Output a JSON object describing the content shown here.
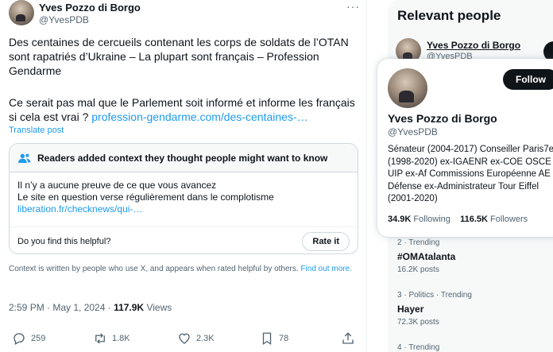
{
  "tweet": {
    "author_name": "Yves Pozzo di Borgo",
    "author_handle": "@YvesPDB",
    "text_line1": "Des centaines de cercueils contenant les corps de soldats de l’OTAN sont rapatriés d’Ukraine – La plupart sont français – Profession Gendarme",
    "text_line2": "Ce serait pas mal que le Parlement soit informé et informe les français si cela est vrai ?",
    "text_link": "profession-gendarme.com/des-centaines-…",
    "translate": "Translate post",
    "timestamp": "2:59 PM · May 1, 2024 · ",
    "views_count": "117.9K",
    "views_label": " Views"
  },
  "community_note": {
    "header": "Readers added context they thought people might want to know",
    "line1": "Il n’y a aucune preuve de ce que vous avancez",
    "line2": "Le site en question verse régulièrement dans le complotisme",
    "link": "liberation.fr/checknews/qui-…",
    "helpful_question": "Do you find this helpful?",
    "rate_button": "Rate it",
    "footer_text": "Context is written by people who use X, and appears when rated helpful by others. ",
    "footer_link": "Find out more."
  },
  "actions": {
    "replies": "259",
    "reposts": "1.8K",
    "likes": "2.3K",
    "bookmarks": "78"
  },
  "sidebar": {
    "relevant_title": "Relevant people",
    "person_name": "Yves Pozzo di Borgo",
    "person_handle": "@YvesPDB",
    "trends": [
      {
        "meta": "2 · Trending",
        "name": "#OMAtalanta",
        "posts": "16.2K posts"
      },
      {
        "meta": "3 · Politics · Trending",
        "name": "Hayer",
        "posts": "72.3K posts"
      },
      {
        "meta": "4 · Trending"
      }
    ]
  },
  "hover_card": {
    "name": "Yves Pozzo di Borgo",
    "handle": "@YvesPDB",
    "follow_label": "Follow",
    "bio": "Sénateur (2004-2017) Conseiller Paris7e (1998-2020) ex-IGAENR ex-COE OSCE UIP ex-Af Commissions Européenne AE Défense ex-Administrateur Tour Eiffel (2001-2020)",
    "following_count": "34.9K",
    "following_label": " Following",
    "followers_count": "116.5K",
    "followers_label": " Followers"
  },
  "colors": {
    "accent": "#1d9bf0",
    "text": "#0f1419",
    "secondary": "#536471"
  }
}
